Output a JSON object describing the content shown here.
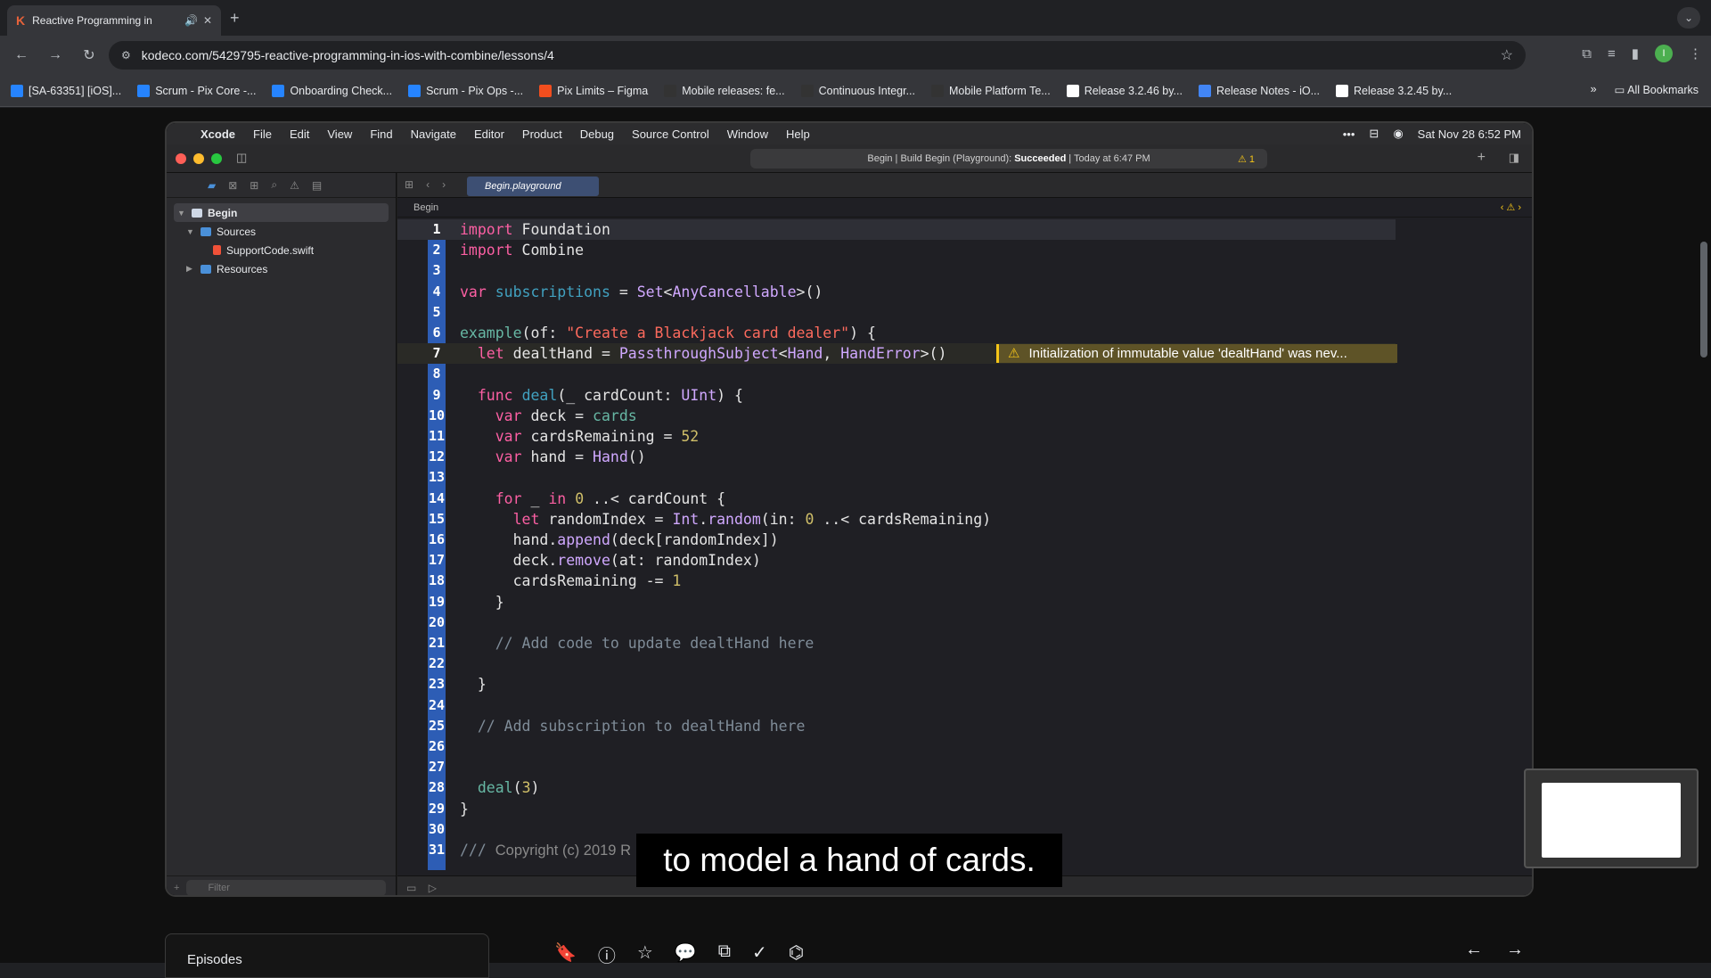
{
  "browser": {
    "tab_title": "Reactive Programming in",
    "url": "kodeco.com/5429795-reactive-programming-in-ios-with-combine/lessons/4",
    "bookmarks": [
      {
        "label": "[SA-63351] [iOS]...",
        "color": "#2684ff"
      },
      {
        "label": "Scrum - Pix Core -...",
        "color": "#2684ff"
      },
      {
        "label": "Onboarding Check...",
        "color": "#2684ff"
      },
      {
        "label": "Scrum - Pix Ops -...",
        "color": "#2684ff"
      },
      {
        "label": "Pix Limits – Figma",
        "color": "#f24e1e"
      },
      {
        "label": "Mobile releases: fe...",
        "color": "#333333"
      },
      {
        "label": "Continuous Integr...",
        "color": "#333333"
      },
      {
        "label": "Mobile Platform Te...",
        "color": "#333333"
      },
      {
        "label": "Release 3.2.46 by...",
        "color": "#ffffff"
      },
      {
        "label": "Release Notes - iO...",
        "color": "#4285f4"
      },
      {
        "label": "Release 3.2.45 by...",
        "color": "#ffffff"
      }
    ],
    "all_bookmarks": "All Bookmarks",
    "profile_initial": "I"
  },
  "mac": {
    "menu": [
      "Xcode",
      "File",
      "Edit",
      "View",
      "Find",
      "Navigate",
      "Editor",
      "Product",
      "Debug",
      "Source Control",
      "Window",
      "Help"
    ],
    "datetime": "Sat Nov 28  6:52 PM"
  },
  "xcode": {
    "status_prefix": "Begin | Build Begin (Playground):",
    "status_result": "Succeeded",
    "status_time": "| Today at 6:47 PM",
    "warning_count": "1",
    "tree": {
      "root": "Begin",
      "sources": "Sources",
      "file": "SupportCode.swift",
      "resources": "Resources"
    },
    "filter_placeholder": "Filter",
    "editor_tab": "Begin.playground",
    "jump_bar": "Begin",
    "warning_message": "Initialization of immutable value 'dealtHand' was nev...",
    "line_numbers": [
      "1",
      "2",
      "3",
      "4",
      "5",
      "6",
      "7",
      "8",
      "9",
      "10",
      "11",
      "12",
      "13",
      "14",
      "15",
      "16",
      "17",
      "18",
      "19",
      "20",
      "21",
      "22",
      "23",
      "24",
      "25",
      "26",
      "27",
      "28",
      "29",
      "30",
      "31"
    ]
  },
  "caption": "to model a hand of cards.",
  "page": {
    "episodes_label": "Episodes"
  },
  "colors": {
    "keyword": "#fc5fa3",
    "type": "#d0a8ff",
    "string": "#fc6a5d",
    "number": "#d0bf69",
    "comment": "#7f8c98",
    "gutter": "#2d5db5",
    "warning": "#f5c518"
  }
}
